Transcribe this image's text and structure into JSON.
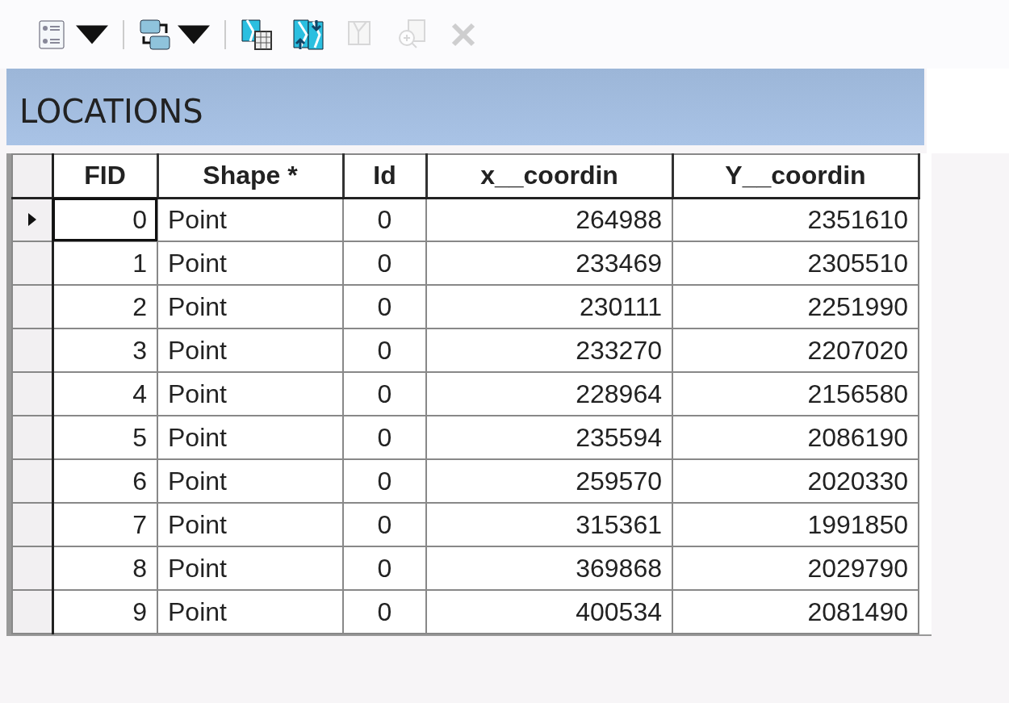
{
  "toolbar": [
    {
      "kind": "list",
      "disabled": false,
      "dropdown": true
    },
    {
      "kind": "relate",
      "disabled": false,
      "dropdown": true
    },
    {
      "kind": "select-by",
      "disabled": false,
      "dropdown": false
    },
    {
      "kind": "switch",
      "disabled": false,
      "dropdown": false
    },
    {
      "kind": "clear",
      "disabled": true,
      "dropdown": false
    },
    {
      "kind": "zoom",
      "disabled": true,
      "dropdown": false
    },
    {
      "kind": "delete",
      "disabled": true,
      "dropdown": false
    }
  ],
  "table": {
    "title": "LOCATIONS",
    "columns": [
      {
        "label": "FID"
      },
      {
        "label": "Shape *"
      },
      {
        "label": "Id"
      },
      {
        "label": "x__coordin"
      },
      {
        "label": "Y__coordin"
      }
    ],
    "rows": [
      {
        "selected": true,
        "cells": [
          "0",
          "Point",
          "0",
          "264988",
          "2351610"
        ]
      },
      {
        "selected": false,
        "cells": [
          "1",
          "Point",
          "0",
          "233469",
          "2305510"
        ]
      },
      {
        "selected": false,
        "cells": [
          "2",
          "Point",
          "0",
          "230111",
          "2251990"
        ]
      },
      {
        "selected": false,
        "cells": [
          "3",
          "Point",
          "0",
          "233270",
          "2207020"
        ]
      },
      {
        "selected": false,
        "cells": [
          "4",
          "Point",
          "0",
          "228964",
          "2156580"
        ]
      },
      {
        "selected": false,
        "cells": [
          "5",
          "Point",
          "0",
          "235594",
          "2086190"
        ]
      },
      {
        "selected": false,
        "cells": [
          "6",
          "Point",
          "0",
          "259570",
          "2020330"
        ]
      },
      {
        "selected": false,
        "cells": [
          "7",
          "Point",
          "0",
          "315361",
          "1991850"
        ]
      },
      {
        "selected": false,
        "cells": [
          "8",
          "Point",
          "0",
          "369868",
          "2029790"
        ]
      },
      {
        "selected": false,
        "cells": [
          "9",
          "Point",
          "0",
          "400534",
          "2081490"
        ]
      }
    ]
  }
}
